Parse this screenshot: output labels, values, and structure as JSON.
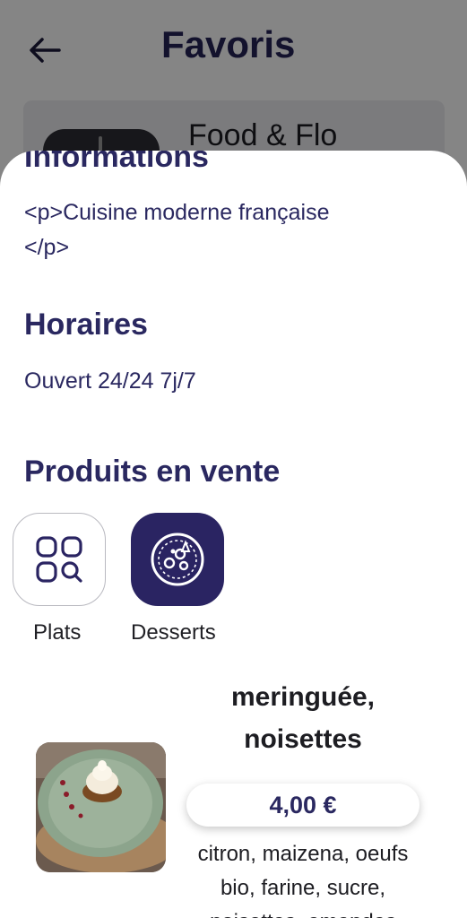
{
  "background": {
    "title": "Favoris",
    "card_name": "Food & Flo"
  },
  "sheet": {
    "informations_title": "Informations",
    "informations_text_line1": "<p>Cuisine moderne française",
    "informations_text_line2": "</p>",
    "horaires_title": "Horaires",
    "horaires_text": "Ouvert 24/24 7j/7",
    "produits_title": "Produits en vente",
    "categories": [
      {
        "label": "Plats",
        "icon": "grid-search-icon",
        "selected": false
      },
      {
        "label": "Desserts",
        "icon": "dessert-plate-icon",
        "selected": true
      }
    ],
    "product": {
      "name_line1": "meringuée,",
      "name_line2": "noisettes",
      "price": "4,00 €",
      "desc_line1": "citron, maizena, oeufs",
      "desc_line2": "bio, farine, sucre,",
      "desc_line3": "noisettes, amandes"
    }
  },
  "colors": {
    "primary": "#2a2860",
    "overlay": "rgba(0,0,0,0.48)"
  }
}
